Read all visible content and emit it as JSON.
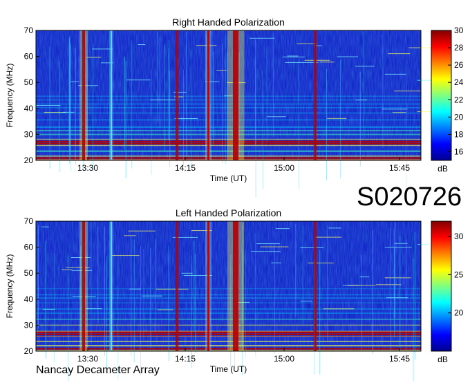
{
  "figure": {
    "observation_id": "S020726",
    "footer": "Nancay Decameter Array",
    "colors": {
      "spectrum_background": "#1428c8",
      "burst": "#b40000"
    }
  },
  "chart_data": [
    {
      "type": "heatmap",
      "title": "Right Handed Polarization",
      "xlabel": "Time (UT)",
      "ylabel": "Frequency (MHz)",
      "x_ticks": [
        "13:30",
        "14:15",
        "15:00",
        "15:45"
      ],
      "y_ticks": [
        20,
        30,
        40,
        50,
        60,
        70
      ],
      "ylim": [
        20,
        70
      ],
      "colorbar_label": "dB",
      "colorbar_ticks": [
        16,
        18,
        20,
        22,
        24,
        26,
        28,
        30
      ],
      "colorbar_range": [
        15,
        30
      ],
      "colormap": "jet"
    },
    {
      "type": "heatmap",
      "title": "Left Handed Polarization",
      "xlabel": "Time (UT)",
      "ylabel": "Frequency (MHz)",
      "x_ticks": [
        "13:30",
        "14:15",
        "15:00",
        "15:45"
      ],
      "y_ticks": [
        20,
        30,
        40,
        50,
        60,
        70
      ],
      "ylim": [
        20,
        70
      ],
      "colorbar_label": "dB",
      "colorbar_ticks": [
        20,
        25,
        30
      ],
      "colorbar_range": [
        15,
        32
      ],
      "colormap": "jet"
    }
  ]
}
